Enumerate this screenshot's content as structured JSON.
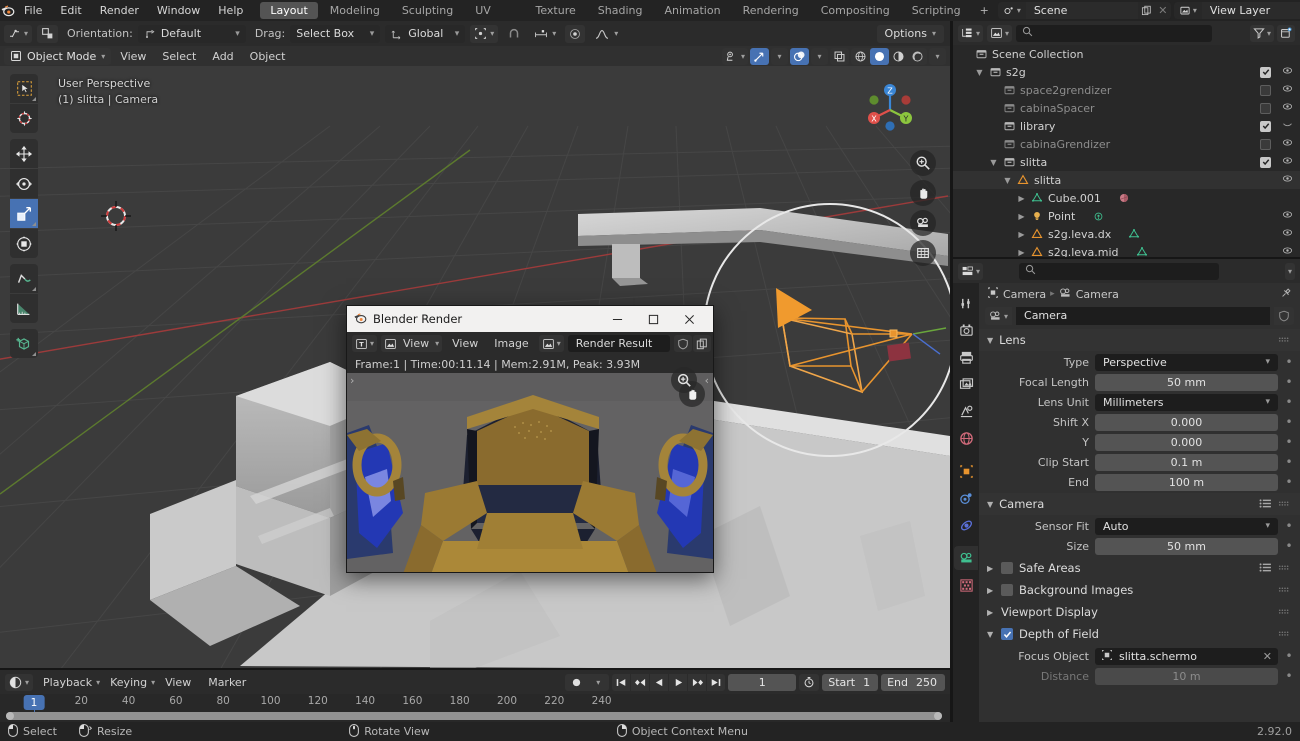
{
  "app": {
    "name": "Blender",
    "version": "2.92.0"
  },
  "topbar": {
    "logo_icon": "blender-logo-icon",
    "menus": [
      "File",
      "Edit",
      "Render",
      "Window",
      "Help"
    ],
    "workspaces": [
      {
        "label": "Layout",
        "active": true
      },
      {
        "label": "Modeling",
        "active": false
      },
      {
        "label": "Sculpting",
        "active": false
      },
      {
        "label": "UV Editing",
        "active": false
      },
      {
        "label": "Texture Paint",
        "active": false
      },
      {
        "label": "Shading",
        "active": false
      },
      {
        "label": "Animation",
        "active": false
      },
      {
        "label": "Rendering",
        "active": false
      },
      {
        "label": "Compositing",
        "active": false
      },
      {
        "label": "Scripting",
        "active": false
      }
    ],
    "add_workspace_label": "+",
    "scene": {
      "icon": "scene-icon",
      "value": "Scene",
      "new_icon": "duplicate-icon",
      "unlink_icon": "close-icon"
    },
    "view_layer": {
      "icon": "view-layer-icon",
      "value": "View Layer",
      "new_icon": "duplicate-icon",
      "unlink_icon": "close-icon"
    }
  },
  "tool_header": {
    "transform_icon": "snap-with-icon",
    "pivot_icon": "pivot-icon",
    "orientation_label": "Orientation:",
    "orientation_value": "Default",
    "drag_label": "Drag:",
    "drag_value": "Select Box",
    "global_value": "Global",
    "snap_icon": "snap-magnet-icon",
    "proportional_icon": "proportional-edit-icon",
    "falloff_icon": "falloff-smooth-icon",
    "options_label": "Options"
  },
  "viewport_header": {
    "mode": "Object Mode",
    "menus": [
      "View",
      "Select",
      "Add",
      "Object"
    ],
    "visibility_icon": "object-visibility-icon",
    "gizmo_icon": "gizmo-icon",
    "gizmo_on": true,
    "overlays_icon": "overlays-icon",
    "overlays_on": true,
    "xray_icon": "xray-icon",
    "shading_modes": [
      {
        "name": "wireframe-shading",
        "active": false
      },
      {
        "name": "solid-shading",
        "active": true
      },
      {
        "name": "material-preview-shading",
        "active": false
      },
      {
        "name": "rendered-shading",
        "active": false
      }
    ]
  },
  "viewport": {
    "perspective_label": "User Perspective",
    "selection_label": "(1) slitta | Camera",
    "gizmo_axes": [
      {
        "label": "X",
        "color": "#e0504a"
      },
      {
        "label": "Y",
        "color": "#8cc63e"
      },
      {
        "label": "Z",
        "color": "#3a86d6"
      }
    ],
    "tools": [
      {
        "name": "tweak-select-box-tool",
        "active": false
      },
      {
        "name": "cursor-tool",
        "active": false
      },
      {
        "name": "move-tool",
        "active": false
      },
      {
        "name": "rotate-tool",
        "active": false
      },
      {
        "name": "scale-tool",
        "active": true
      },
      {
        "name": "transform-tool",
        "active": false
      },
      {
        "name": "annotate-tool",
        "active": false
      },
      {
        "name": "measure-tool",
        "active": false
      },
      {
        "name": "add-cube-tool",
        "active": false
      }
    ],
    "nav_buttons": [
      {
        "name": "zoom-view-icon"
      },
      {
        "name": "pan-view-icon"
      },
      {
        "name": "camera-view-icon"
      },
      {
        "name": "toggle-orthographic-icon"
      }
    ]
  },
  "render_window": {
    "title": "Blender Render",
    "logo_icon": "blender-logo-icon",
    "minimize_icon": "minimize-icon",
    "maximize_icon": "maximize-icon",
    "close_icon": "close-icon",
    "editor_type_icon": "image-editor-icon",
    "view_mode": "View",
    "menus": [
      "View",
      "Image"
    ],
    "image_icon": "image-datablock-icon",
    "image_name": "Render Result",
    "fake_user_icon": "shield-icon",
    "copy_icon": "duplicate-icon",
    "stats": "Frame:1 | Time:00:11.14 | Mem:2.91M, Peak: 3.93M",
    "zoom_icon": "zoom-icon",
    "pan_icon": "pan-hand-icon"
  },
  "outliner": {
    "display_mode_icon": "outliner-display-mode-icon",
    "filter_id_icon": "filter-id-icon",
    "search_placeholder": "",
    "search_value": "",
    "filter_icon": "funnel-icon",
    "new_collection_icon": "new-collection-icon",
    "rows": [
      {
        "indent": 0,
        "disclosure": "",
        "icon": "collection-icon",
        "icon_color": "#b9b9b9",
        "name": "Scene Collection",
        "dim": false,
        "checkbox": null,
        "eye": false,
        "extra_icon": null
      },
      {
        "indent": 1,
        "disclosure": "down",
        "icon": "collection-icon",
        "icon_color": "#b9b9b9",
        "name": "s2g",
        "dim": false,
        "checkbox": true,
        "eye": true,
        "extra_icon": null
      },
      {
        "indent": 2,
        "disclosure": "",
        "icon": "collection-icon",
        "icon_color": "#8a8a8a",
        "name": "space2grendizer",
        "dim": true,
        "checkbox": false,
        "eye": true,
        "extra_icon": null
      },
      {
        "indent": 2,
        "disclosure": "",
        "icon": "collection-icon",
        "icon_color": "#8a8a8a",
        "name": "cabinaSpacer",
        "dim": true,
        "checkbox": false,
        "eye": true,
        "extra_icon": null
      },
      {
        "indent": 2,
        "disclosure": "",
        "icon": "collection-icon",
        "icon_color": "#b9b9b9",
        "name": "library",
        "dim": false,
        "checkbox": true,
        "eye": "closed",
        "extra_icon": null
      },
      {
        "indent": 2,
        "disclosure": "",
        "icon": "collection-icon",
        "icon_color": "#8a8a8a",
        "name": "cabinaGrendizer",
        "dim": true,
        "checkbox": false,
        "eye": true,
        "extra_icon": null
      },
      {
        "indent": 2,
        "disclosure": "down",
        "icon": "collection-icon",
        "icon_color": "#b9b9b9",
        "name": "slitta",
        "dim": false,
        "checkbox": true,
        "eye": true,
        "extra_icon": null
      },
      {
        "indent": 3,
        "disclosure": "down",
        "icon": "empty-axes-icon",
        "icon_color": "#e8942e",
        "name": "slitta",
        "dim": false,
        "checkbox": null,
        "eye": true,
        "extra_icon": null
      },
      {
        "indent": 4,
        "disclosure": "right",
        "icon": "mesh-data-icon",
        "icon_color": "#3fbf8f",
        "name": "Cube.001",
        "dim": false,
        "checkbox": null,
        "eye": false,
        "extra_icon": "material-icon"
      },
      {
        "indent": 4,
        "disclosure": "right",
        "icon": "light-point-icon",
        "icon_color": "#e8b04e",
        "name": "Point",
        "dim": false,
        "checkbox": null,
        "eye": true,
        "extra_icon": "light-data-icon"
      },
      {
        "indent": 4,
        "disclosure": "right",
        "icon": "empty-axes-icon",
        "icon_color": "#e8942e",
        "name": "s2g.leva.dx",
        "dim": false,
        "checkbox": null,
        "eye": true,
        "extra_icon": "mesh-data-icon"
      },
      {
        "indent": 4,
        "disclosure": "right",
        "icon": "empty-axes-icon",
        "icon_color": "#e8942e",
        "name": "s2g.leva.mid",
        "dim": false,
        "checkbox": null,
        "eye": true,
        "extra_icon": "mesh-data-icon"
      }
    ]
  },
  "properties": {
    "editor_icon": "properties-editor-icon",
    "search_placeholder": "",
    "search_value": "",
    "expand_icon": "chevron-down-icon",
    "tabs": [
      {
        "name": "tool-tab",
        "glyph": "tool",
        "color": "#c9c9c9",
        "active": false
      },
      {
        "name": "render-tab",
        "glyph": "render",
        "color": "#c9c9c9",
        "active": false
      },
      {
        "name": "output-tab",
        "glyph": "output",
        "color": "#c9c9c9",
        "active": false
      },
      {
        "name": "view-layer-tab",
        "glyph": "viewlayer",
        "color": "#c9c9c9",
        "active": false
      },
      {
        "name": "scene-tab",
        "glyph": "scene",
        "color": "#c9c9c9",
        "active": false
      },
      {
        "name": "world-tab",
        "glyph": "world",
        "color": "#d06a7a",
        "active": false
      },
      {
        "name": "object-tab",
        "glyph": "object",
        "color": "#e8942e",
        "active": false
      },
      {
        "name": "modifier-tab",
        "glyph": "modifier",
        "color": "#5a8fd8",
        "active": false
      },
      {
        "name": "physics-tab",
        "glyph": "physics",
        "color": "#5a6fd8",
        "active": false
      },
      {
        "name": "camera-data-tab",
        "glyph": "camera",
        "color": "#3fbf8f",
        "active": true
      },
      {
        "name": "texture-tab",
        "glyph": "texture",
        "color": "#d06a7a",
        "active": false
      }
    ],
    "breadcrumb": [
      {
        "icon": "object-icon",
        "label": "Camera"
      },
      {
        "icon": "camera-data-icon",
        "label": "Camera"
      }
    ],
    "pin_icon": "pin-icon",
    "datablock": {
      "icon": "camera-data-icon",
      "name": "Camera",
      "fake_user_icon": "shield-icon"
    },
    "lens_panel": {
      "title": "Lens",
      "fields": [
        {
          "label": "Type",
          "value": "Perspective",
          "kind": "dropdown"
        },
        {
          "label": "Focal Length",
          "value": "50 mm",
          "kind": "number"
        },
        {
          "label": "Lens Unit",
          "value": "Millimeters",
          "kind": "dropdown"
        },
        {
          "label": "Shift X",
          "value": "0.000",
          "kind": "number"
        },
        {
          "label": "Y",
          "value": "0.000",
          "kind": "number"
        },
        {
          "label": "Clip Start",
          "value": "0.1 m",
          "kind": "number"
        },
        {
          "label": "End",
          "value": "100 m",
          "kind": "number"
        }
      ]
    },
    "camera_panel": {
      "title": "Camera",
      "fields": [
        {
          "label": "Sensor Fit",
          "value": "Auto",
          "kind": "dropdown"
        },
        {
          "label": "Size",
          "value": "50 mm",
          "kind": "number"
        }
      ]
    },
    "collapsed_panels": [
      {
        "title": "Safe Areas",
        "checkbox": false,
        "has_checkbox": true
      },
      {
        "title": "Background Images",
        "checkbox": false,
        "has_checkbox": true
      },
      {
        "title": "Viewport Display",
        "checkbox": null,
        "has_checkbox": false
      }
    ],
    "dof_panel": {
      "title": "Depth of Field",
      "checkbox": true,
      "fields": [
        {
          "label": "Focus Object",
          "value": "slitta.schermo",
          "kind": "object",
          "icon": "object-icon"
        },
        {
          "label": "Distance",
          "value": "10 m",
          "kind": "number",
          "dim": true
        }
      ]
    }
  },
  "timeline": {
    "editor_icon": "timeline-editor-icon",
    "menus": [
      "Playback",
      "Keying",
      "View",
      "Marker"
    ],
    "record_icon": "record-icon",
    "nav_buttons": [
      {
        "name": "jump-to-start-button",
        "glyph": "jump-start"
      },
      {
        "name": "previous-keyframe-button",
        "glyph": "prev-key"
      },
      {
        "name": "play-reverse-button",
        "glyph": "play-rev"
      },
      {
        "name": "play-button",
        "glyph": "play"
      },
      {
        "name": "next-keyframe-button",
        "glyph": "next-key"
      },
      {
        "name": "jump-to-end-button",
        "glyph": "jump-end"
      }
    ],
    "current_frame": "1",
    "timer_icon": "stopwatch-icon",
    "start_label": "Start",
    "start_value": "1",
    "end_label": "End",
    "end_value": "250",
    "ruler_ticks": [
      "20",
      "40",
      "60",
      "80",
      "100",
      "120",
      "140",
      "160",
      "180",
      "200",
      "220",
      "240"
    ],
    "playhead_label": "1"
  },
  "statusbar": {
    "items": [
      {
        "icon": "mouse-left-icon",
        "label": "Select"
      },
      {
        "icon": "mouse-left-drag-icon",
        "label": "Resize"
      },
      {
        "icon": "mouse-middle-icon",
        "label": "Rotate View"
      },
      {
        "icon": "mouse-right-icon",
        "label": "Object Context Menu"
      }
    ],
    "version": "2.92.0"
  },
  "colors": {
    "accent_blue": "#4772b3",
    "orange_select": "#e8942e",
    "bg_dark": "#232323",
    "bg_mid": "#2b2b2b",
    "viewport_bg": "#3b3b3b"
  }
}
